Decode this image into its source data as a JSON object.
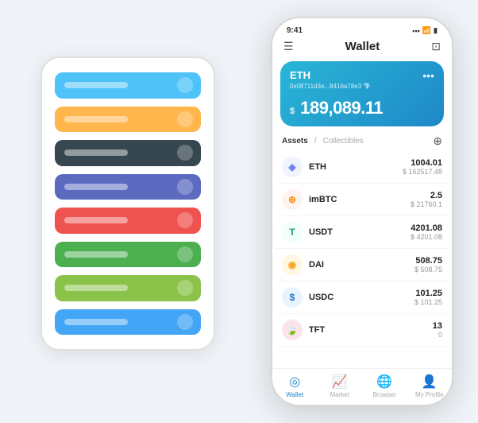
{
  "scene": {
    "background_color": "#f0f4f8"
  },
  "phone_back": {
    "cards": [
      {
        "id": "card-blue",
        "color": "#4fc3f7",
        "label_visible": true,
        "icon": true
      },
      {
        "id": "card-orange",
        "color": "#ffb74d",
        "label_visible": true,
        "icon": true
      },
      {
        "id": "card-dark",
        "color": "#37474f",
        "label_visible": true,
        "icon": true
      },
      {
        "id": "card-purple",
        "color": "#5c6bc0",
        "label_visible": true,
        "icon": true
      },
      {
        "id": "card-red",
        "color": "#ef5350",
        "label_visible": true,
        "icon": true
      },
      {
        "id": "card-green",
        "color": "#4caf50",
        "label_visible": true,
        "icon": true
      },
      {
        "id": "card-light-green",
        "color": "#8bc34a",
        "label_visible": true,
        "icon": true
      },
      {
        "id": "card-steel-blue",
        "color": "#42a5f5",
        "label_visible": true,
        "icon": true
      }
    ]
  },
  "phone_front": {
    "status_bar": {
      "time": "9:41",
      "signal": "▪▪▪",
      "wifi": "WiFi",
      "battery": "🔋"
    },
    "header": {
      "menu_icon": "☰",
      "title": "Wallet",
      "scan_icon": "⊡"
    },
    "wallet_card": {
      "token": "ETH",
      "address": "0x08711d3e...8416a78e3",
      "address_suffix": "💎",
      "dots_label": "•••",
      "currency_symbol": "$",
      "amount": "189,089.11"
    },
    "assets_section": {
      "tab_active": "Assets",
      "tab_divider": "/",
      "tab_secondary": "Collectibles",
      "add_icon": "⊕"
    },
    "assets": [
      {
        "id": "eth",
        "name": "ETH",
        "icon_char": "◈",
        "icon_color": "#627eea",
        "icon_bg": "#f0f4ff",
        "amount": "1004.01",
        "usd": "$ 162517.48"
      },
      {
        "id": "imbtc",
        "name": "imBTC",
        "icon_char": "⊕",
        "icon_color": "#f7931a",
        "icon_bg": "#fff3f0",
        "amount": "2.5",
        "usd": "$ 21760.1"
      },
      {
        "id": "usdt",
        "name": "USDT",
        "icon_char": "T",
        "icon_color": "#26a17b",
        "icon_bg": "#f0fff8",
        "amount": "4201.08",
        "usd": "$ 4201.08"
      },
      {
        "id": "dai",
        "name": "DAI",
        "icon_char": "◉",
        "icon_color": "#f5a623",
        "icon_bg": "#fff8e1",
        "amount": "508.75",
        "usd": "$ 508.75"
      },
      {
        "id": "usdc",
        "name": "USDC",
        "icon_char": "$",
        "icon_color": "#2775ca",
        "icon_bg": "#e8f4fd",
        "amount": "101.25",
        "usd": "$ 101.25"
      },
      {
        "id": "tft",
        "name": "TFT",
        "icon_char": "🍃",
        "icon_color": "#e91e63",
        "icon_bg": "#fce4ec",
        "amount": "13",
        "usd": "0"
      }
    ],
    "bottom_nav": [
      {
        "id": "wallet",
        "icon": "◎",
        "label": "Wallet",
        "active": true
      },
      {
        "id": "market",
        "icon": "📈",
        "label": "Market",
        "active": false
      },
      {
        "id": "browser",
        "icon": "🌐",
        "label": "Browser",
        "active": false
      },
      {
        "id": "profile",
        "icon": "👤",
        "label": "My Profile",
        "active": false
      }
    ]
  }
}
